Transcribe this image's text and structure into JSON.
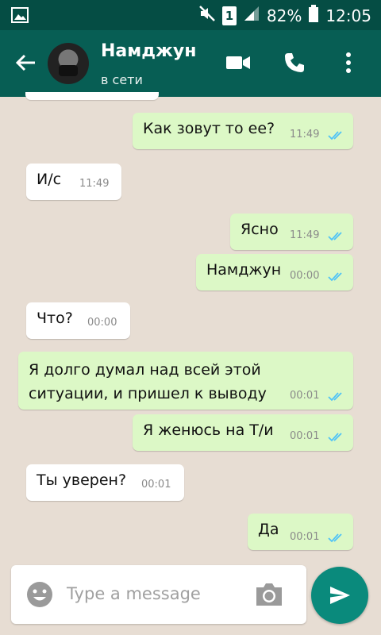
{
  "statusbar": {
    "battery": "82%",
    "time": "12:05",
    "sim": "1"
  },
  "header": {
    "contact_name": "Намджун",
    "contact_status": "в сети"
  },
  "messages": [
    {
      "text": "Как зовут то ее?",
      "time": "11:49",
      "side": "out"
    },
    {
      "text": "И/с",
      "time": "11:49",
      "side": "in"
    },
    {
      "text": "Ясно",
      "time": "11:49",
      "side": "out"
    },
    {
      "text": "Намджун",
      "time": "00:00",
      "side": "out"
    },
    {
      "text": "Что?",
      "time": "00:00",
      "side": "in"
    },
    {
      "text_line1": "Я долго думал над всей этой",
      "text_line2": "ситуации,  и пришел к выводу",
      "time": "00:01",
      "side": "out"
    },
    {
      "text": "Я женюсь на Т/и",
      "time": "00:01",
      "side": "out"
    },
    {
      "text": "Ты уверен?",
      "time": "00:01",
      "side": "in"
    },
    {
      "text": "Да",
      "time": "00:01",
      "side": "out"
    }
  ],
  "composer": {
    "placeholder": "Type a message"
  },
  "colors": {
    "header": "#075e54",
    "statusbar": "#054d44",
    "outgoing": "#dcf8c6",
    "incoming": "#ffffff",
    "send": "#0a8a7c",
    "read_ticks": "#4fc3f7"
  }
}
